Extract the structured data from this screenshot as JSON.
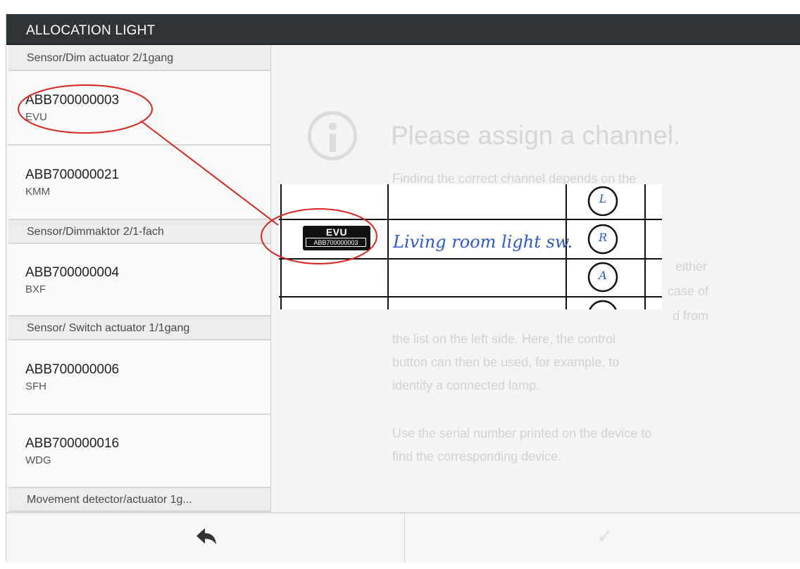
{
  "window": {
    "title": "ALLOCATION LIGHT"
  },
  "sidebar": {
    "items": [
      {
        "kind": "group",
        "label": "Sensor/Dim actuator 2/1gang"
      },
      {
        "kind": "device",
        "serial": "ABB700000003",
        "name": "EVU",
        "highlighted": true
      },
      {
        "kind": "device",
        "serial": "ABB700000021",
        "name": "KMM"
      },
      {
        "kind": "group",
        "label": "Sensor/Dimmaktor 2/1-fach"
      },
      {
        "kind": "device",
        "serial": "ABB700000004",
        "name": "BXF"
      },
      {
        "kind": "group",
        "label": "Sensor/ Switch actuator 1/1gang"
      },
      {
        "kind": "device",
        "serial": "ABB700000006",
        "name": "SFH"
      },
      {
        "kind": "device",
        "serial": "ABB700000016",
        "name": "WDG"
      },
      {
        "kind": "group",
        "label": "Movement detector/actuator 1g..."
      }
    ]
  },
  "main": {
    "heading": "Please assign a channel.",
    "para1_visible": "Finding the correct channel depends on the",
    "para1_frag_a": "either",
    "para1_frag_b": "case of",
    "para1_frag_c": "d from",
    "para1_line_a": "the list on the left side. Here, the control",
    "para1_line_b": "button can then be used, for example, to",
    "para1_line_c": "identify a connected lamp.",
    "para2_line_a": "Use the serial number printed on the device to",
    "para2_line_b": "find the corresponding device."
  },
  "callout": {
    "label_name": "EVU",
    "label_serial": "ABB700000003",
    "handwritten": "Living room light sw.",
    "circles": [
      "L",
      "R",
      "A"
    ]
  },
  "colors": {
    "titlebar": "#2f3439",
    "annotation_red": "#d9261c",
    "handwriting_blue": "#2e58c9"
  },
  "icons": {
    "info": "info-icon",
    "back": "back-arrow-icon",
    "confirm": "checkmark-icon"
  }
}
